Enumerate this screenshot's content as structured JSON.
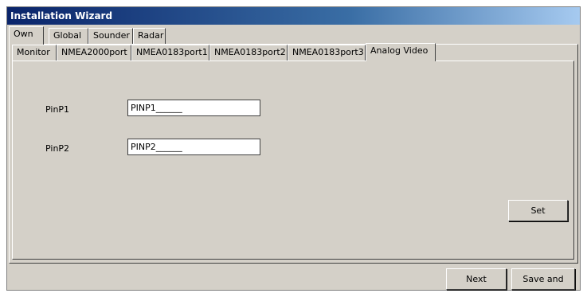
{
  "window": {
    "title": "Installation Wizard"
  },
  "tabs_top": [
    {
      "label": "Own",
      "active": true
    },
    {
      "label": "Global",
      "active": false
    },
    {
      "label": "Sounder",
      "active": false
    },
    {
      "label": "Radar",
      "active": false
    }
  ],
  "tabs_sub": [
    {
      "label": "Monitor",
      "active": false
    },
    {
      "label": "NMEA2000port",
      "active": false
    },
    {
      "label": "NMEA0183port1",
      "active": false
    },
    {
      "label": "NMEA0183port2",
      "active": false
    },
    {
      "label": "NMEA0183port3",
      "active": false
    },
    {
      "label": "Analog Video",
      "active": true
    }
  ],
  "form": {
    "pinp1_label": "PinP1",
    "pinp1_value": "PINP1______",
    "pinp2_label": "PinP2",
    "pinp2_value": "PINP2______"
  },
  "buttons": {
    "set": "Set",
    "next": "Next",
    "save_and": "Save and"
  },
  "colors": {
    "face": "#d4d0c8",
    "title_start": "#0a246a",
    "title_end": "#a6caf0"
  }
}
